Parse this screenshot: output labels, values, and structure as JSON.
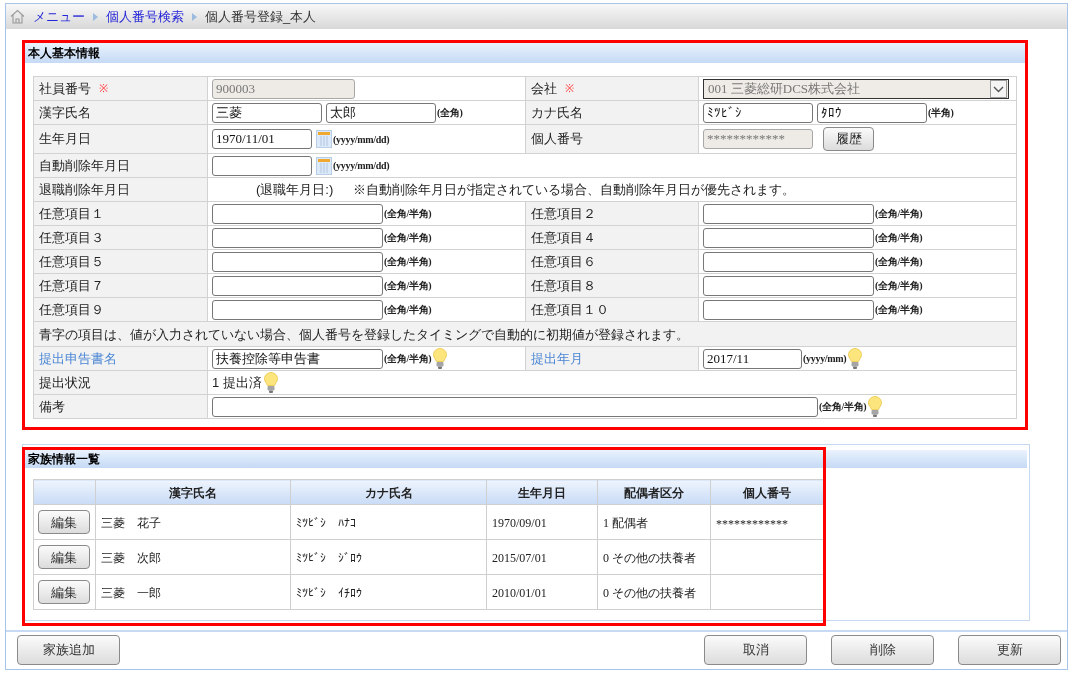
{
  "breadcrumb": [
    {
      "label": "メニュー",
      "kind": "link"
    },
    {
      "label": "個人番号検索",
      "kind": "link"
    },
    {
      "label": "個人番号登録_本人",
      "kind": "current"
    }
  ],
  "personal_info": {
    "title": "本人基本情報",
    "highlighted": true,
    "rows": [
      {
        "kind": "pair",
        "fields": [
          {
            "label": "社員番号",
            "required_mark": "※",
            "auto_default": false,
            "controls": [
              {
                "kind": "medium",
                "value": "900003",
                "disabled": true
              }
            ]
          },
          {
            "label": "会社",
            "required_mark": "※",
            "auto_default": false,
            "controls": [
              {
                "kind": "select",
                "value": "001 三菱総研DCS株式会社",
                "disabled": true
              }
            ]
          }
        ]
      },
      {
        "kind": "pair",
        "fields": [
          {
            "label": "漢字氏名",
            "auto_default": false,
            "controls": [
              {
                "kind": "short",
                "value": "三菱",
                "disabled": false
              },
              {
                "kind": "short",
                "value": "太郎",
                "disabled": false
              },
              {
                "kind": "hint",
                "text": "(全角)"
              }
            ]
          },
          {
            "label": "カナ氏名",
            "auto_default": false,
            "controls": [
              {
                "kind": "short",
                "value": "ﾐﾂﾋﾞｼ",
                "disabled": false
              },
              {
                "kind": "short",
                "value": "ﾀﾛｳ",
                "disabled": false
              },
              {
                "kind": "hint",
                "text": "(半角)"
              }
            ]
          }
        ]
      },
      {
        "kind": "pair",
        "fields": [
          {
            "label": "生年月日",
            "auto_default": false,
            "controls": [
              {
                "kind": "date",
                "value": "1970/11/01",
                "disabled": false
              },
              {
                "kind": "calendar"
              },
              {
                "kind": "hint",
                "text": "(yyyy/mm/dd)"
              }
            ]
          },
          {
            "label": "個人番号",
            "auto_default": false,
            "controls": [
              {
                "kind": "short",
                "value": "************",
                "disabled": true
              },
              {
                "kind": "button",
                "label": "履歴"
              }
            ]
          }
        ]
      },
      {
        "kind": "single",
        "fields": [
          {
            "label": "自動削除年月日",
            "auto_default": false,
            "controls": [
              {
                "kind": "date",
                "disabled": false
              },
              {
                "kind": "calendar"
              },
              {
                "kind": "hint",
                "text": "(yyyy/mm/dd)"
              }
            ]
          }
        ]
      },
      {
        "kind": "single",
        "fields": [
          {
            "label": "退職削除年月日",
            "auto_default": false,
            "controls": [
              {
                "kind": "retire_date",
                "text": "(退職年月日:)"
              },
              {
                "kind": "static",
                "text": "※自動削除年月日が指定されている場合、自動削除年月日が優先されます。"
              }
            ]
          }
        ]
      },
      {
        "kind": "pair",
        "fields": [
          {
            "label": "任意項目１",
            "auto_default": false,
            "controls": [
              {
                "kind": "text",
                "disabled": false
              },
              {
                "kind": "hint",
                "text": "(全角/半角)"
              }
            ]
          },
          {
            "label": "任意項目２",
            "auto_default": false,
            "controls": [
              {
                "kind": "text",
                "disabled": false
              },
              {
                "kind": "hint",
                "text": "(全角/半角)"
              }
            ]
          }
        ]
      },
      {
        "kind": "pair",
        "fields": [
          {
            "label": "任意項目３",
            "auto_default": false,
            "controls": [
              {
                "kind": "text",
                "disabled": false
              },
              {
                "kind": "hint",
                "text": "(全角/半角)"
              }
            ]
          },
          {
            "label": "任意項目４",
            "auto_default": false,
            "controls": [
              {
                "kind": "text",
                "disabled": false
              },
              {
                "kind": "hint",
                "text": "(全角/半角)"
              }
            ]
          }
        ]
      },
      {
        "kind": "pair",
        "fields": [
          {
            "label": "任意項目５",
            "auto_default": false,
            "controls": [
              {
                "kind": "text",
                "disabled": false
              },
              {
                "kind": "hint",
                "text": "(全角/半角)"
              }
            ]
          },
          {
            "label": "任意項目６",
            "auto_default": false,
            "controls": [
              {
                "kind": "text",
                "disabled": false
              },
              {
                "kind": "hint",
                "text": "(全角/半角)"
              }
            ]
          }
        ]
      },
      {
        "kind": "pair",
        "fields": [
          {
            "label": "任意項目７",
            "auto_default": false,
            "controls": [
              {
                "kind": "text",
                "disabled": false
              },
              {
                "kind": "hint",
                "text": "(全角/半角)"
              }
            ]
          },
          {
            "label": "任意項目８",
            "auto_default": false,
            "controls": [
              {
                "kind": "text",
                "disabled": false
              },
              {
                "kind": "hint",
                "text": "(全角/半角)"
              }
            ]
          }
        ]
      },
      {
        "kind": "pair",
        "fields": [
          {
            "label": "任意項目９",
            "auto_default": false,
            "controls": [
              {
                "kind": "text",
                "disabled": false
              },
              {
                "kind": "hint",
                "text": "(全角/半角)"
              }
            ]
          },
          {
            "label": "任意項目１０",
            "auto_default": false,
            "controls": [
              {
                "kind": "text",
                "disabled": false
              },
              {
                "kind": "hint",
                "text": "(全角/半角)"
              }
            ]
          }
        ]
      },
      {
        "kind": "note",
        "text": "青字の項目は、値が入力されていない場合、個人番号を登録したタイミングで自動的に初期値が登録されます。"
      },
      {
        "kind": "pair",
        "fields": [
          {
            "label": "提出申告書名",
            "auto_default": true,
            "controls": [
              {
                "kind": "text",
                "value": "扶養控除等申告書",
                "disabled": false
              },
              {
                "kind": "hint",
                "text": "(全角/半角)"
              },
              {
                "kind": "tip"
              }
            ]
          },
          {
            "label": "提出年月",
            "auto_default": true,
            "controls": [
              {
                "kind": "month",
                "value": "2017/11",
                "disabled": false
              },
              {
                "kind": "hint",
                "text": "(yyyy/mm)"
              },
              {
                "kind": "tip"
              }
            ]
          }
        ]
      },
      {
        "kind": "single",
        "fields": [
          {
            "label": "提出状況",
            "auto_default": false,
            "controls": [
              {
                "kind": "static",
                "text": "1 提出済"
              },
              {
                "kind": "tip"
              }
            ]
          }
        ]
      },
      {
        "kind": "single",
        "fields": [
          {
            "label": "備考",
            "auto_default": false,
            "controls": [
              {
                "kind": "wide",
                "disabled": false
              },
              {
                "kind": "hint",
                "text": "(全角/半角)"
              },
              {
                "kind": "tip"
              }
            ]
          }
        ]
      }
    ]
  },
  "family": {
    "title": "家族情報一覧",
    "highlighted": true,
    "columns": [
      "漢字氏名",
      "カナ氏名",
      "生年月日",
      "配偶者区分",
      "個人番号"
    ],
    "rows": [
      {
        "edit_button": "編集",
        "kanji_name": "三菱　花子",
        "kana_name": "ﾐﾂﾋﾞｼ　ﾊﾅｺ",
        "birth_date": "1970/09/01",
        "spouse_type": "1 配偶者",
        "my_number": "************"
      },
      {
        "edit_button": "編集",
        "kanji_name": "三菱　次郎",
        "kana_name": "ﾐﾂﾋﾞｼ　ｼﾞﾛｳ",
        "birth_date": "2015/07/01",
        "spouse_type": "0 その他の扶養者"
      },
      {
        "edit_button": "編集",
        "kanji_name": "三菱　一郎",
        "kana_name": "ﾐﾂﾋﾞｼ　ｲﾁﾛｳ",
        "birth_date": "2010/01/01",
        "spouse_type": "0 その他の扶養者"
      }
    ]
  },
  "footer": {
    "left_buttons": [
      "家族追加"
    ],
    "right_buttons": [
      "取消",
      "削除",
      "更新"
    ]
  }
}
